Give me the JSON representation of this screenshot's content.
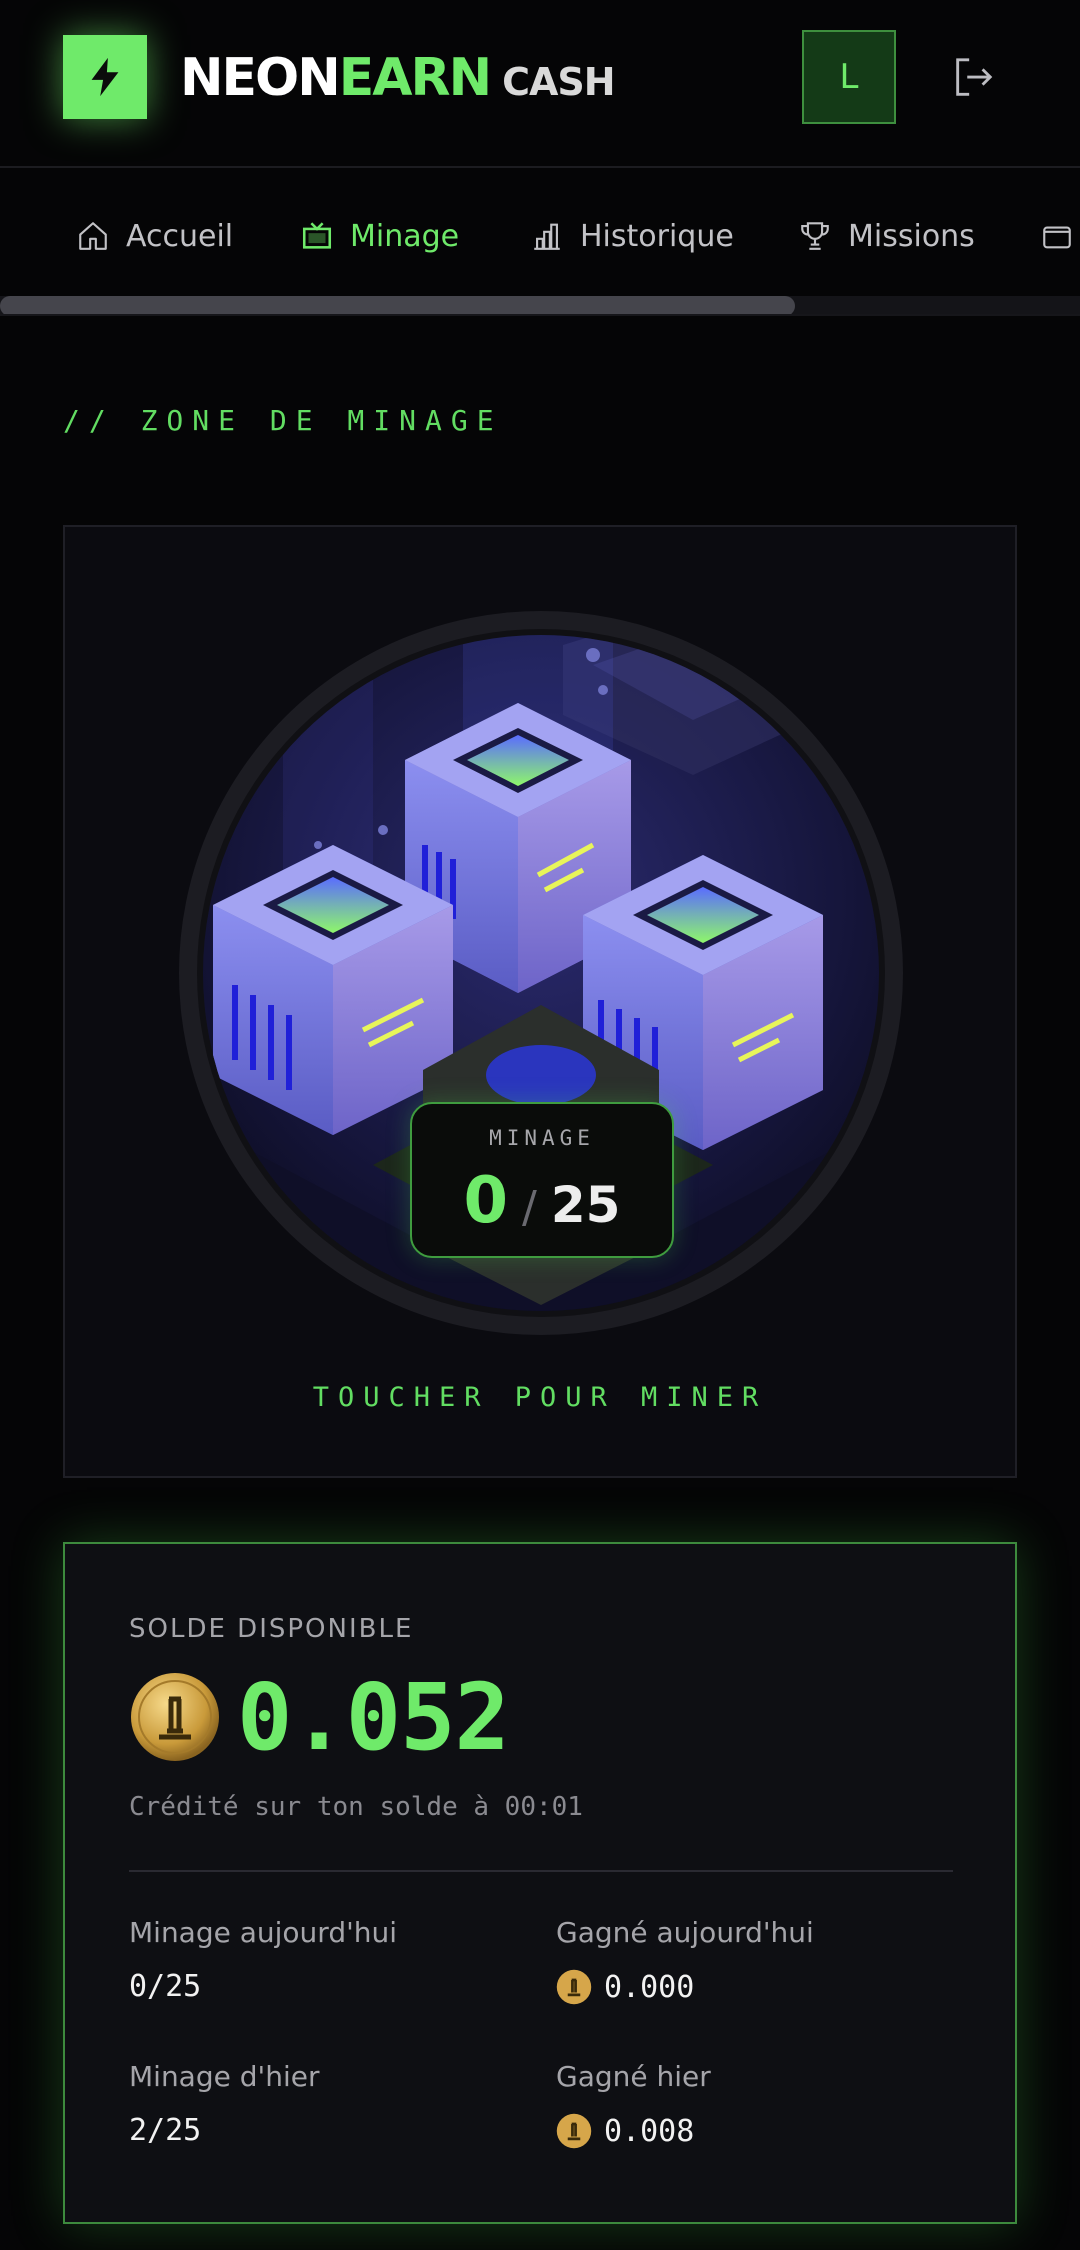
{
  "header": {
    "brand_part1": "NEON",
    "brand_part2": "EARN",
    "brand_part3": "CASH",
    "avatar_initial": "L",
    "accent_color": "#6fea6a"
  },
  "nav": {
    "items": [
      {
        "label": "Accueil",
        "icon": "home-icon",
        "active": false
      },
      {
        "label": "Minage",
        "icon": "tv-icon",
        "active": true
      },
      {
        "label": "Historique",
        "icon": "bar-chart-icon",
        "active": false
      },
      {
        "label": "Missions",
        "icon": "trophy-icon",
        "active": false
      },
      {
        "label": "",
        "icon": "wallet-icon",
        "active": false
      }
    ],
    "scroll_position": 0.73
  },
  "mining": {
    "section_title": "// ZONE DE MINAGE",
    "counter_label": "MINAGE",
    "current": "0",
    "separator": "/",
    "max": "25",
    "tap_hint": "TOUCHER POUR MINER"
  },
  "balance": {
    "label": "SOLDE DISPONIBLE",
    "amount": "0.052",
    "note": "Crédité sur ton solde à 00:01",
    "stats": {
      "today_mining_label": "Minage aujourd'hui",
      "today_mining_value": "0/25",
      "today_earned_label": "Gagné aujourd'hui",
      "today_earned_value": "0.000",
      "yesterday_mining_label": "Minage d'hier",
      "yesterday_mining_value": "2/25",
      "yesterday_earned_label": "Gagné hier",
      "yesterday_earned_value": "0.008"
    }
  }
}
